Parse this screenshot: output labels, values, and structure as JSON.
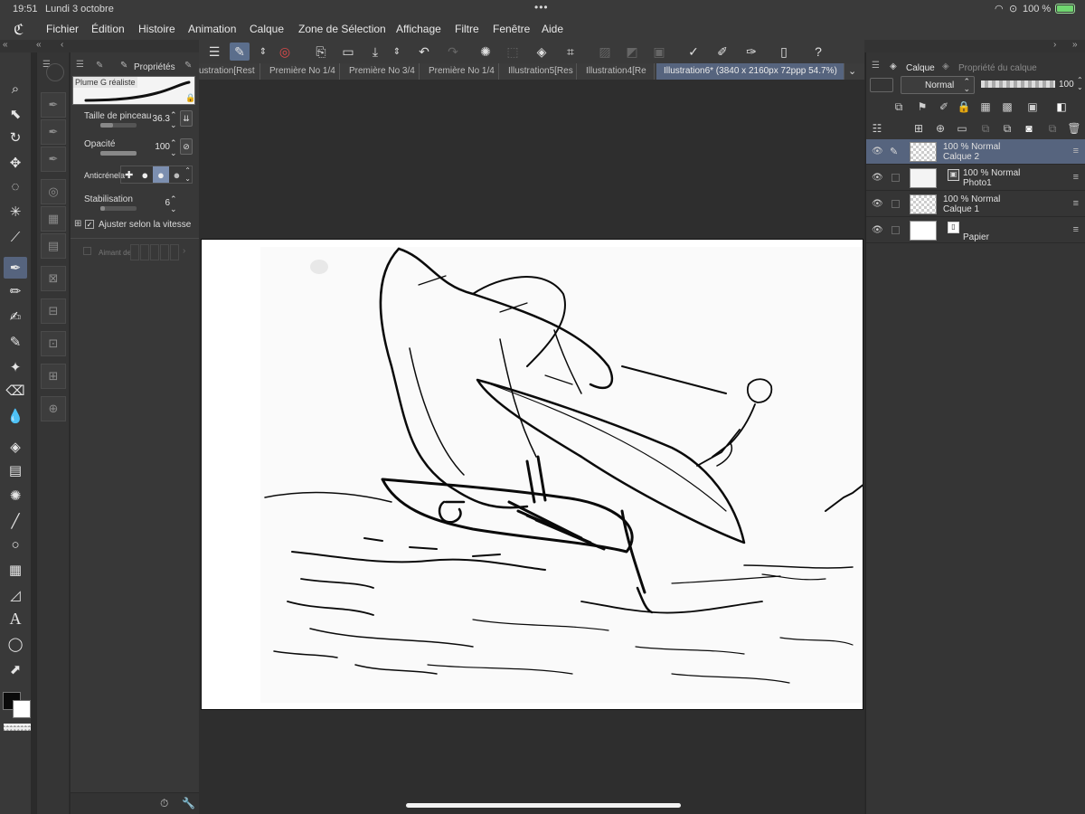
{
  "status": {
    "time": "19:51",
    "date": "Lundi 3 octobre",
    "battery": "100 %"
  },
  "menu": [
    "Fichier",
    "Édition",
    "Histoire",
    "Animation",
    "Calque",
    "Zone de Sélection",
    "Affichage",
    "Filtre",
    "Fenêtre",
    "Aide"
  ],
  "tool_property": {
    "tab_label": "Propriétés",
    "brush_name": "Plume G réaliste",
    "brush_size_label": "Taille de pinceau",
    "brush_size_value": "36.3",
    "opacity_label": "Opacité",
    "opacity_value": "100",
    "antialias_label": "Anticrénela",
    "stabilization_label": "Stabilisation",
    "stabilization_value": "6",
    "speed_label": "Ajuster selon la vitesse",
    "magnet_label": "Aimant de"
  },
  "tabs": [
    "ustration[Rest",
    "Première No 1/4",
    "Première No 3/4",
    "Première No 1/4",
    "Illustration5[Res",
    "Illustration4[Re",
    "Illustration6* (3840 x 2160px 72ppp 54.7%)"
  ],
  "layer_panel": {
    "tab_layer": "Calque",
    "tab_props": "Propriété du calque",
    "blend_mode": "Normal",
    "opacity": "100",
    "layers": [
      {
        "line1": "100 % Normal",
        "line2": "Calque 2",
        "selected": true
      },
      {
        "line1": "100 % Normal",
        "line2": "Photo1",
        "selected": false
      },
      {
        "line1": "100 % Normal",
        "line2": "Calque 1",
        "selected": false
      },
      {
        "line1": "",
        "line2": "Papier",
        "selected": false
      }
    ]
  },
  "colors": {
    "accent": "#56647e",
    "panel": "#383838",
    "background": "#2b2b2b"
  }
}
